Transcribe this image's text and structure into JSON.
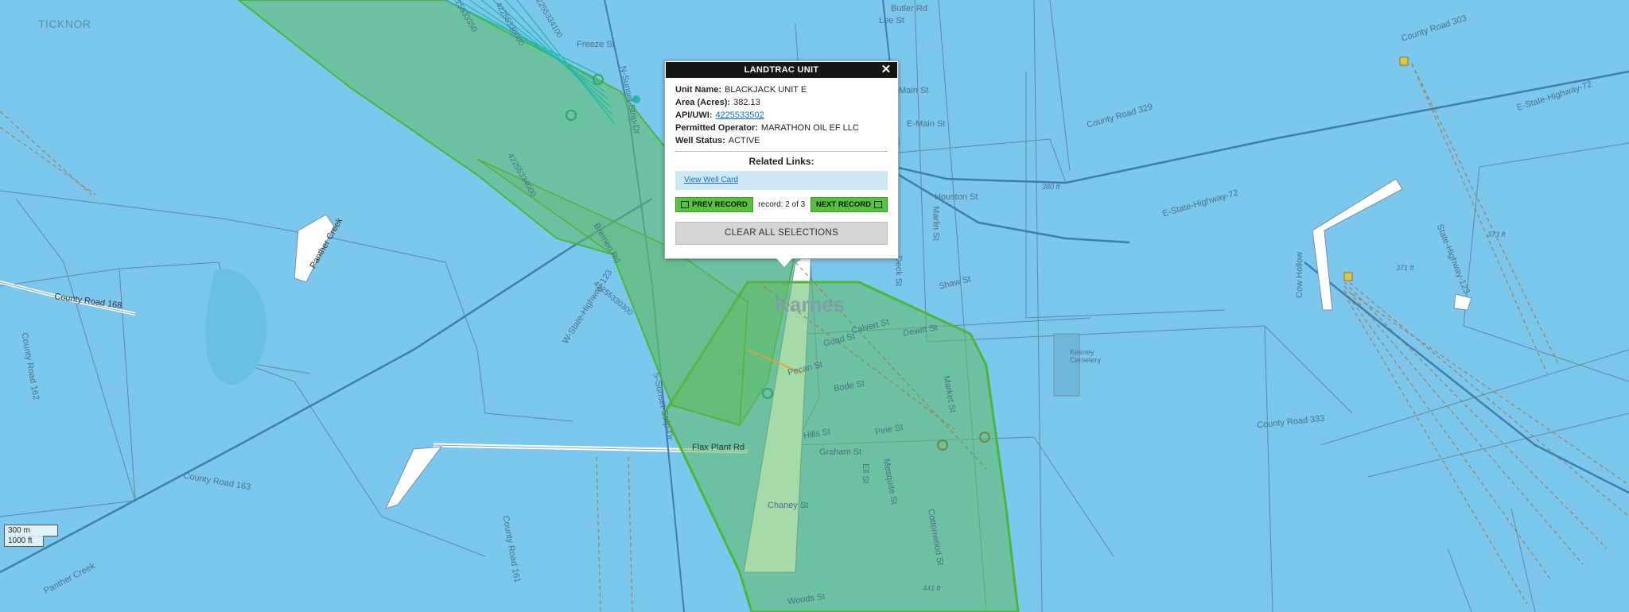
{
  "popup": {
    "title": "LANDTRAC UNIT",
    "close_label": "✕",
    "fields": [
      {
        "key": "Unit Name:",
        "value": "BLACKJACK UNIT E"
      },
      {
        "key": "Area (Acres):",
        "value": "382.13"
      },
      {
        "key": "API/UWI:",
        "value": "4225533502"
      },
      {
        "key": "Permitted Operator:",
        "value": "MARATHON OIL EF LLC"
      },
      {
        "key": "Well Status:",
        "value": "ACTIVE"
      }
    ],
    "related_title": "Related Links:",
    "related_link": "View Well Card",
    "prev_label": "PREV RECORD",
    "next_label": "NEXT RECORD",
    "record_text": "record: 2 of 3",
    "clear_label": "CLEAR ALL SELECTIONS"
  },
  "scale": {
    "metric": "300 m",
    "imperial": "1000 ft"
  },
  "map": {
    "colors": {
      "water_bg": "#7cc7ee",
      "unit_fill": "#5dbb63",
      "unit_stroke": "#4cb43a",
      "road": "#3b7ea8"
    },
    "town": "Karnes",
    "places": [
      "TICKNOR",
      "Keeney Cemetery",
      "Cow Hollow"
    ],
    "labels": [
      "County Road 303",
      "E-State-Highway-72",
      "County Road 329",
      "E-State-Highway-72",
      "Houston St",
      "Marlin St",
      "Deck St",
      "Shaw St",
      "Dewitt St",
      "Calvert St",
      "Goad St",
      "Pecan St",
      "Bode St",
      "Pine St",
      "Hills St",
      "Graham St",
      "Ell St",
      "Chaney St",
      "Woods St",
      "Flax Plant Rd",
      "County Road 163",
      "County Road 161",
      "County Road 162",
      "County Road 168",
      "Panther Creek",
      "Panther Creek",
      "W-State-Highway-123",
      "S-Sunset-Strip-Dr",
      "N-Sunset-Strip-Dr",
      "County Road 333",
      "State-Highway-123",
      "Freeze St",
      "Butler Rd",
      "Lee St",
      "Main St",
      "E-Main St",
      "Bremen Rd",
      "Mesquite St",
      "Cottonwood St",
      "Market St",
      "373 ft",
      "371 ft",
      "441 ft",
      "380 ft",
      "42255334000",
      "42255336000",
      "42255330300",
      "42255334100",
      "4225533350"
    ]
  }
}
